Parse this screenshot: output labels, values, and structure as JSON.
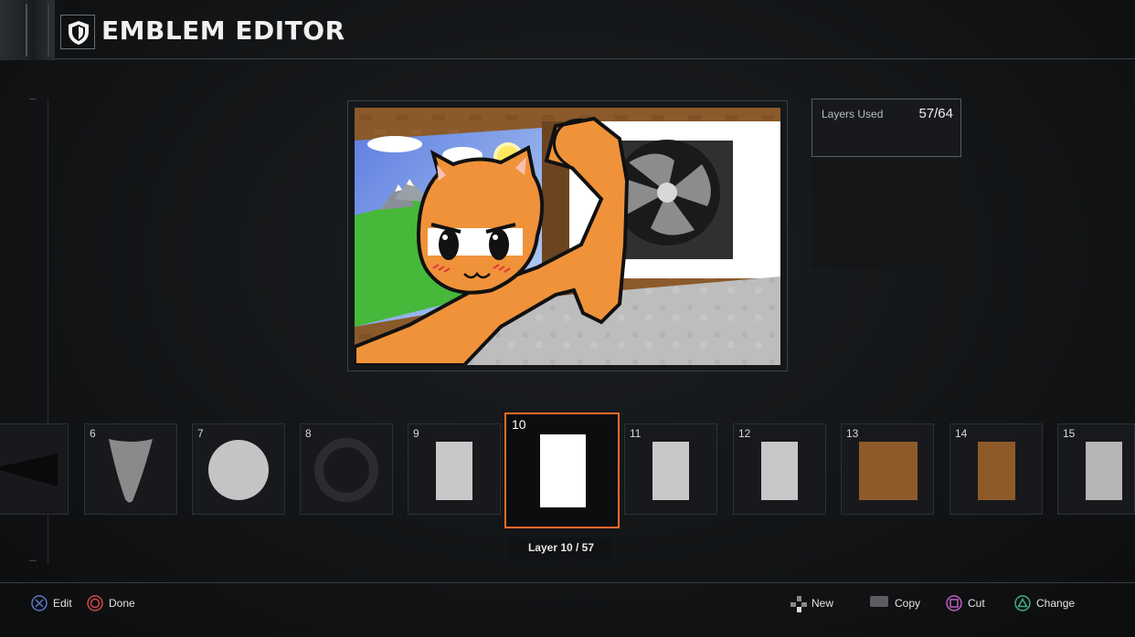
{
  "header": {
    "title": "EMBLEM EDITOR",
    "icon": "shield-icon"
  },
  "layers_used": {
    "label": "Layers Used",
    "value": "57/64"
  },
  "layer_strip": [
    {
      "num": "",
      "shape": "dark-wedge"
    },
    {
      "num": "6",
      "shape": "gray-cone"
    },
    {
      "num": "7",
      "shape": "light-circle"
    },
    {
      "num": "8",
      "shape": "dark-ring"
    },
    {
      "num": "9",
      "shape": "light-rect"
    },
    {
      "num": "10",
      "shape": "white-rect",
      "selected": true
    },
    {
      "num": "11",
      "shape": "light-rect"
    },
    {
      "num": "12",
      "shape": "light-rect"
    },
    {
      "num": "13",
      "shape": "brown-rect"
    },
    {
      "num": "14",
      "shape": "brown-rect"
    },
    {
      "num": "15",
      "shape": "concrete-rect"
    }
  ],
  "layer_caption": "Layer 10 / 57",
  "footer": {
    "edit": "Edit",
    "done": "Done",
    "new": "New",
    "copy": "Copy",
    "cut": "Cut",
    "change": "Change"
  },
  "colors": {
    "accent": "#ff6a2a",
    "cross": "#5a78c8",
    "circle": "#d04848",
    "square": "#c060c0",
    "triangle": "#40b080"
  }
}
